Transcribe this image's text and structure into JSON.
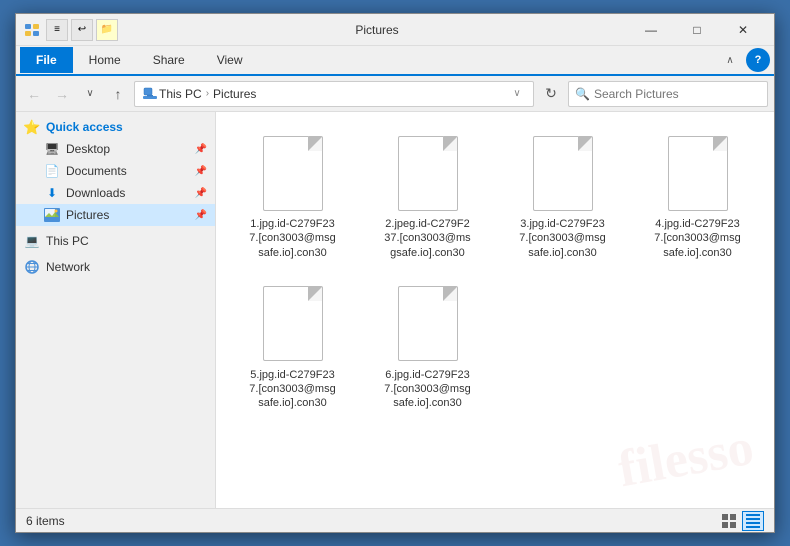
{
  "window": {
    "title": "Pictures",
    "icon": "📁"
  },
  "titlebar": {
    "tabs": [
      "≡",
      "↩",
      "▶"
    ],
    "title": "Pictures",
    "minimize": "—",
    "maximize": "□",
    "close": "✕"
  },
  "ribbon": {
    "tabs": [
      "File",
      "Home",
      "Share",
      "View"
    ],
    "active_tab": "File",
    "chevron_label": "∧",
    "help_label": "?"
  },
  "addressbar": {
    "back_disabled": true,
    "forward_disabled": true,
    "up_label": "↑",
    "path": [
      "This PC",
      "Pictures"
    ],
    "path_chevron": "∨",
    "refresh_label": "↻",
    "search_placeholder": "Search Pictures"
  },
  "sidebar": {
    "items": [
      {
        "id": "quick-access",
        "label": "Quick access",
        "icon": "⭐",
        "level": 0,
        "pinned": false
      },
      {
        "id": "desktop",
        "label": "Desktop",
        "icon": "🖥",
        "level": 1,
        "pinned": true
      },
      {
        "id": "documents",
        "label": "Documents",
        "icon": "📄",
        "level": 1,
        "pinned": true
      },
      {
        "id": "downloads",
        "label": "Downloads",
        "icon": "⬇",
        "level": 1,
        "pinned": true
      },
      {
        "id": "pictures",
        "label": "Pictures",
        "icon": "🖼",
        "level": 1,
        "pinned": true,
        "active": true
      },
      {
        "id": "this-pc",
        "label": "This PC",
        "icon": "💻",
        "level": 0,
        "pinned": false
      },
      {
        "id": "network",
        "label": "Network",
        "icon": "🌐",
        "level": 0,
        "pinned": false
      }
    ]
  },
  "files": {
    "items": [
      {
        "id": "file1",
        "name": "1.jpg.id-C279F23\n7.[con3003@msg\nsafe.io].con30"
      },
      {
        "id": "file2",
        "name": "2.jpeg.id-C279F2\n37.[con3003@ms\ngsafe.io].con30"
      },
      {
        "id": "file3",
        "name": "3.jpg.id-C279F23\n7.[con3003@msg\nsafe.io].con30"
      },
      {
        "id": "file4",
        "name": "4.jpg.id-C279F23\n7.[con3003@msg\nsafe.io].con30"
      },
      {
        "id": "file5",
        "name": "5.jpg.id-C279F23\n7.[con3003@msg\nsafe.io].con30"
      },
      {
        "id": "file6",
        "name": "6.jpg.id-C279F23\n7.[con3003@msg\nsafe.io].con30"
      }
    ]
  },
  "statusbar": {
    "count": "6 items"
  },
  "icons": {
    "back": "←",
    "forward": "→",
    "up": "↑",
    "refresh": "↻",
    "search": "🔍",
    "grid_view": "⊞",
    "list_view": "☰",
    "pin": "📌"
  }
}
